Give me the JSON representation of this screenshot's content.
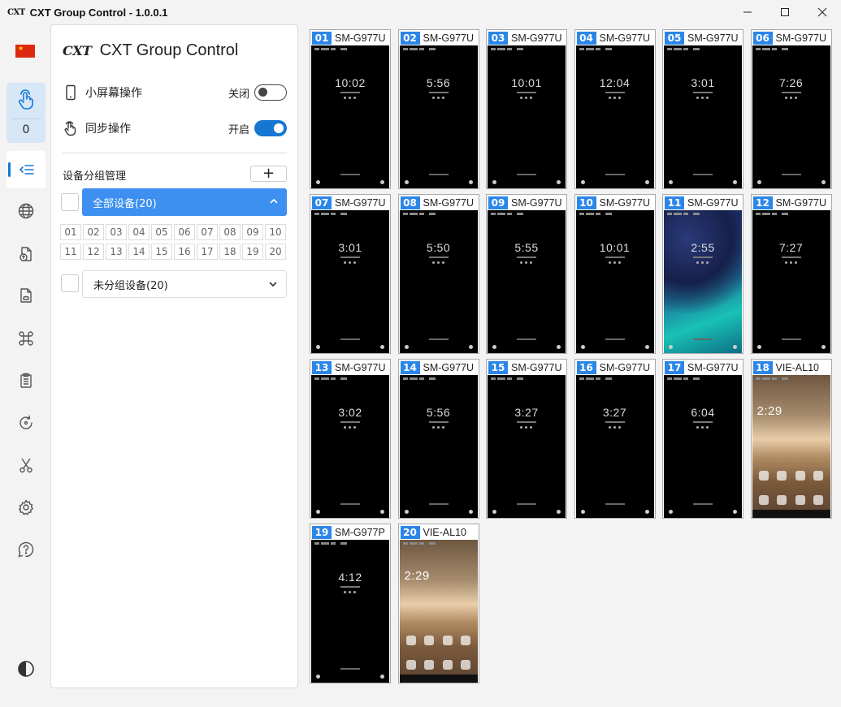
{
  "window": {
    "logo": "CXT",
    "title": "CXT Group Control - 1.0.0.1"
  },
  "rail": {
    "touch_count": "0"
  },
  "panel": {
    "brand_mark": "CXT",
    "brand_name": "CXT Group Control",
    "options": [
      {
        "label": "小屏幕操作",
        "state": "关闭",
        "on": false
      },
      {
        "label": "同步操作",
        "state": "开启",
        "on": true
      }
    ],
    "group_title": "设备分组管理",
    "add_label": "+",
    "groups": [
      {
        "label": "全部设备(20)",
        "expanded": true
      },
      {
        "label": "未分组设备(20)",
        "expanded": false
      }
    ],
    "numbers": [
      "01",
      "02",
      "03",
      "04",
      "05",
      "06",
      "07",
      "08",
      "09",
      "10",
      "11",
      "12",
      "13",
      "14",
      "15",
      "16",
      "17",
      "18",
      "19",
      "20"
    ]
  },
  "colors": {
    "accent": "#1677d2",
    "group_active": "#3d8ff0",
    "device_badge": "#2b86e8"
  },
  "devices": [
    {
      "num": "01",
      "model": "SM-G977U",
      "time": "10:02",
      "screen": "dark"
    },
    {
      "num": "02",
      "model": "SM-G977U",
      "time": "5:56",
      "screen": "dark"
    },
    {
      "num": "03",
      "model": "SM-G977U",
      "time": "10:01",
      "screen": "dark"
    },
    {
      "num": "04",
      "model": "SM-G977U",
      "time": "12:04",
      "screen": "dark"
    },
    {
      "num": "05",
      "model": "SM-G977U",
      "time": "3:01",
      "screen": "dark"
    },
    {
      "num": "06",
      "model": "SM-G977U",
      "time": "7:26",
      "screen": "dark"
    },
    {
      "num": "07",
      "model": "SM-G977U",
      "time": "3:01",
      "screen": "dark"
    },
    {
      "num": "08",
      "model": "SM-G977U",
      "time": "5:50",
      "screen": "dark"
    },
    {
      "num": "09",
      "model": "SM-G977U",
      "time": "5:55",
      "screen": "dark"
    },
    {
      "num": "10",
      "model": "SM-G977U",
      "time": "10:01",
      "screen": "dark"
    },
    {
      "num": "11",
      "model": "SM-G977U",
      "time": "2:55",
      "screen": "galaxy"
    },
    {
      "num": "12",
      "model": "SM-G977U",
      "time": "7:27",
      "screen": "dark"
    },
    {
      "num": "13",
      "model": "SM-G977U",
      "time": "3:02",
      "screen": "dark"
    },
    {
      "num": "14",
      "model": "SM-G977U",
      "time": "5:56",
      "screen": "dark"
    },
    {
      "num": "15",
      "model": "SM-G977U",
      "time": "3:27",
      "screen": "dark"
    },
    {
      "num": "16",
      "model": "SM-G977U",
      "time": "3:27",
      "screen": "dark"
    },
    {
      "num": "17",
      "model": "SM-G977U",
      "time": "6:04",
      "screen": "dark"
    },
    {
      "num": "18",
      "model": "VIE-AL10",
      "time": "2:29",
      "screen": "gold"
    },
    {
      "num": "19",
      "model": "SM-G977P",
      "time": "4:12",
      "screen": "dark"
    },
    {
      "num": "20",
      "model": "VIE-AL10",
      "time": "2:29",
      "screen": "gold"
    }
  ]
}
